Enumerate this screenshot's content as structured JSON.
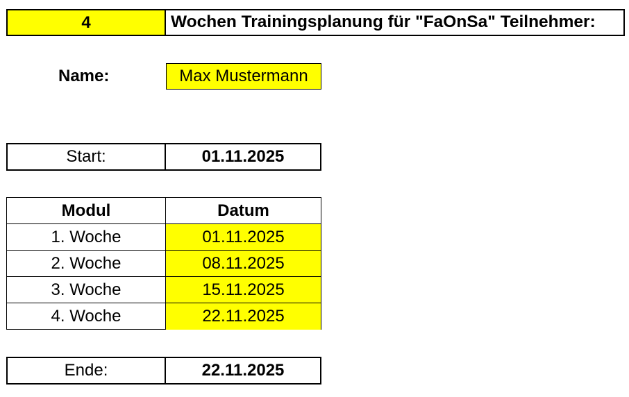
{
  "header": {
    "weeks": "4",
    "title": "Wochen Trainingsplanung für \"FaOnSa\" Teilnehmer:"
  },
  "name": {
    "label": "Name:",
    "value": "Max Mustermann"
  },
  "start": {
    "label": "Start:",
    "value": "01.11.2025"
  },
  "schedule": {
    "headers": [
      "Modul",
      "Datum"
    ],
    "rows": [
      {
        "modul": "1. Woche",
        "datum": "01.11.2025"
      },
      {
        "modul": "2. Woche",
        "datum": "08.11.2025"
      },
      {
        "modul": "3. Woche",
        "datum": "15.11.2025"
      },
      {
        "modul": "4. Woche",
        "datum": "22.11.2025"
      }
    ]
  },
  "end": {
    "label": "Ende:",
    "value": "22.11.2025"
  },
  "colors": {
    "highlight": "#ffff00",
    "border": "#000000",
    "background": "#ffffff"
  }
}
